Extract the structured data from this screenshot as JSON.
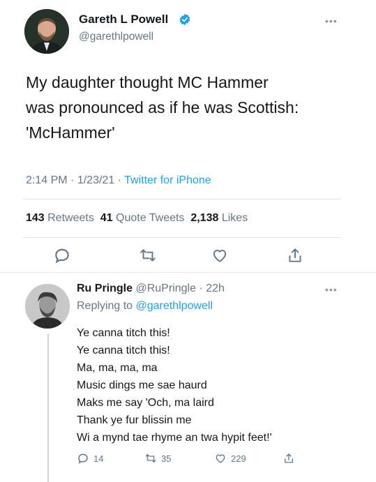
{
  "tweet": {
    "author_name": "Gareth L Powell",
    "author_handle": "@garethlpowell",
    "text_lines": [
      "My daughter thought MC Hammer",
      "was pronounced as if he was Scottish:",
      "'McHammer'"
    ],
    "time": "2:14 PM",
    "date": "1/23/21",
    "source": "Twitter for iPhone",
    "retweets_count": "143",
    "retweets_label": "Retweets",
    "quotes_count": "41",
    "quotes_label": "Quote Tweets",
    "likes_count": "2,138",
    "likes_label": "Likes",
    "verified_icon": "verified-badge-icon",
    "accent_color": "#1da1f2"
  },
  "reply": {
    "author_name": "Ru Pringle",
    "author_handle": "@RuPringle",
    "age": "22h",
    "replying_to_label": "Replying to",
    "replying_to_handle": "@garethlpowell",
    "lines": [
      "Ye canna titch this!",
      "Ye canna titch this!",
      "Ma, ma, ma, ma",
      "Music dings me sae haurd",
      "Maks me say 'Och, ma laird",
      "Thank ye fur blissin me",
      "Wi a mynd tae rhyme an twa hypit feet!'"
    ],
    "reply_count": "14",
    "retweet_count": "35",
    "like_count": "229"
  }
}
